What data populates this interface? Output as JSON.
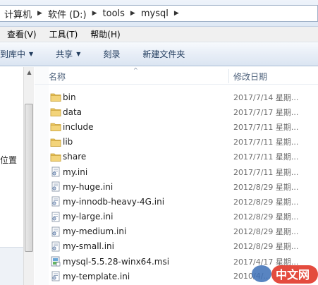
{
  "address": {
    "crumbs": [
      "计算机",
      "软件 (D:)",
      "tools",
      "mysql"
    ]
  },
  "menu": [
    "查看(V)",
    "工具(T)",
    "帮助(H)"
  ],
  "toolbar": {
    "include_library": "到库中",
    "share": "共享",
    "burn": "刻录",
    "new_folder": "新建文件夹"
  },
  "nav": {
    "partial_item": "位置"
  },
  "columns": {
    "name": "名称",
    "date": "修改日期"
  },
  "files": [
    {
      "name": "bin",
      "date": "2017/7/14 星期...",
      "type": "folder"
    },
    {
      "name": "data",
      "date": "2017/7/17 星期...",
      "type": "folder"
    },
    {
      "name": "include",
      "date": "2017/7/11 星期...",
      "type": "folder"
    },
    {
      "name": "lib",
      "date": "2017/7/11 星期...",
      "type": "folder"
    },
    {
      "name": "share",
      "date": "2017/7/11 星期...",
      "type": "folder"
    },
    {
      "name": "my.ini",
      "date": "2017/7/11 星期...",
      "type": "ini"
    },
    {
      "name": "my-huge.ini",
      "date": "2012/8/29 星期...",
      "type": "ini"
    },
    {
      "name": "my-innodb-heavy-4G.ini",
      "date": "2012/8/29 星期...",
      "type": "ini"
    },
    {
      "name": "my-large.ini",
      "date": "2012/8/29 星期...",
      "type": "ini"
    },
    {
      "name": "my-medium.ini",
      "date": "2012/8/29 星期...",
      "type": "ini"
    },
    {
      "name": "my-small.ini",
      "date": "2012/8/29 星期...",
      "type": "ini"
    },
    {
      "name": "mysql-5.5.28-winx64.msi",
      "date": "2017/4/17 星期...",
      "type": "msi"
    },
    {
      "name": "my-template.ini",
      "date": "2010/4/...",
      "type": "ini"
    }
  ],
  "watermark": {
    "text": "中文网"
  },
  "colors": {
    "folder": "#e8c25a",
    "toolbar_text": "#1e395b",
    "header_text": "#4c607a",
    "watermark_red": "#e23c2e"
  }
}
